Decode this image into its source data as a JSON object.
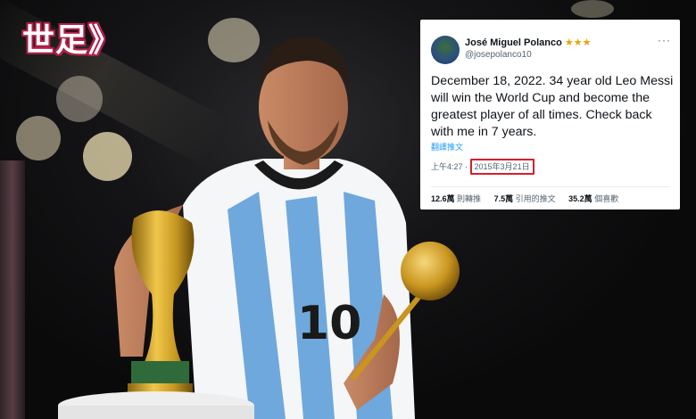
{
  "logo": {
    "text": "世足》"
  },
  "tweet": {
    "author_name": "José Miguel Polanco",
    "author_badge": "★★★",
    "handle": "@josepolanco10",
    "more_icon": "ellipsis-icon",
    "text": "December 18, 2022. 34 year old Leo Messi will win the World Cup and become the greatest player of all times. Check back with me in 7 years.",
    "translate_link": "翻譯推文",
    "time": "上午4:27 ·",
    "date": "2015年3月21日",
    "stats": {
      "retweets_value": "12.6萬",
      "retweets_label": "則轉推",
      "quotes_value": "7.5萬",
      "quotes_label": "引用的推文",
      "likes_value": "35.2萬",
      "likes_label": "個喜歡"
    }
  },
  "photo": {
    "subject": "player holding trophy",
    "jersey_number": "10",
    "colors": {
      "jersey_blue": "#6fa8dc",
      "trophy_gold": "#d4a62a",
      "background": "#0c0c0d",
      "highlight_red": "#d61f2c"
    }
  }
}
